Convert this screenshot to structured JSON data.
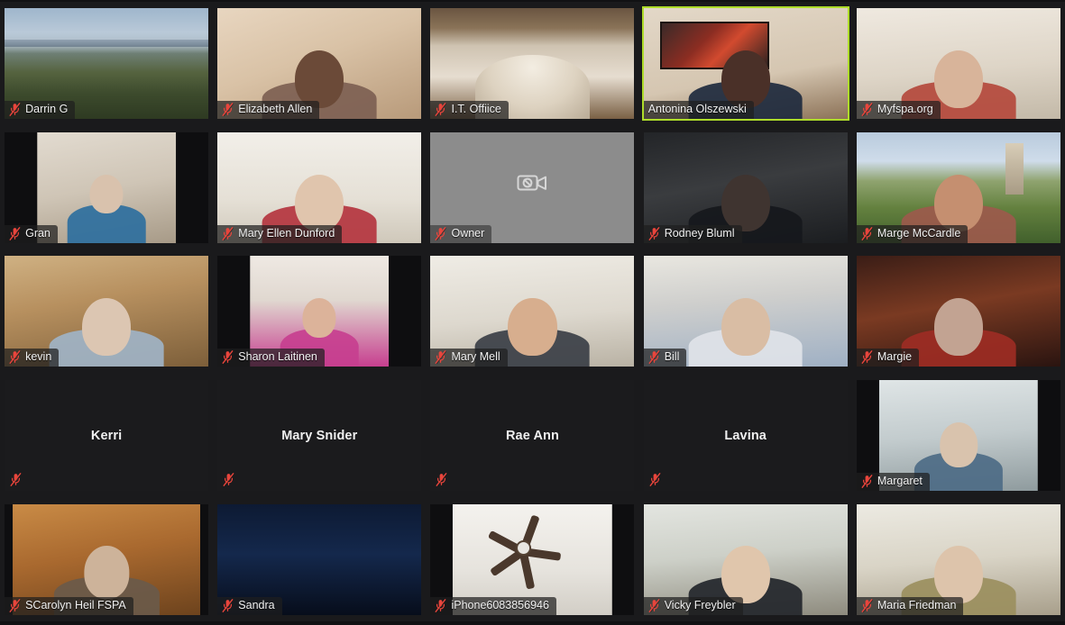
{
  "app": {
    "name": "Zoom Meeting",
    "view": "Gallery View",
    "grid": {
      "columns": 5,
      "rows": 5
    },
    "colors": {
      "background": "#111113",
      "active_speaker_border": "#aedc2a",
      "mute_icon": "#e8453c",
      "name_label_text": "#f2f2f2",
      "video_off_tile": "#1b1b1d",
      "placeholder_tile": "#8c8c8c"
    }
  },
  "participants": [
    {
      "name": "Darrin G",
      "muted": true,
      "video": "on",
      "active_speaker": false,
      "scene": "s-lake",
      "frame": "full",
      "row": 1,
      "col": 1
    },
    {
      "name": "Elizabeth Allen",
      "muted": true,
      "video": "on",
      "active_speaker": false,
      "scene": "s-room-warm",
      "frame": "full",
      "row": 1,
      "col": 2
    },
    {
      "name": "I.T. Offiice",
      "muted": true,
      "video": "on",
      "active_speaker": false,
      "scene": "s-church",
      "frame": "full",
      "row": 1,
      "col": 3
    },
    {
      "name": "Antonina Olszewski",
      "muted": false,
      "video": "on",
      "active_speaker": true,
      "scene": "s-office-art",
      "frame": "full",
      "row": 1,
      "col": 4
    },
    {
      "name": "Myfspa.org",
      "muted": true,
      "video": "on",
      "active_speaker": false,
      "scene": "s-plain-light",
      "frame": "full",
      "row": 1,
      "col": 5
    },
    {
      "name": "Gran",
      "muted": true,
      "video": "on",
      "active_speaker": false,
      "scene": "s-beige-room",
      "frame": "w68",
      "row": 2,
      "col": 1
    },
    {
      "name": "Mary Ellen Dunford",
      "muted": true,
      "video": "on",
      "active_speaker": false,
      "scene": "s-white-room",
      "frame": "full",
      "row": 2,
      "col": 2
    },
    {
      "name": "Owner",
      "muted": true,
      "video": "placeholder",
      "active_speaker": false,
      "scene": "",
      "frame": "full",
      "row": 2,
      "col": 3
    },
    {
      "name": "Rodney Bluml",
      "muted": true,
      "video": "on",
      "active_speaker": false,
      "scene": "s-dark-room",
      "frame": "full",
      "row": 2,
      "col": 4
    },
    {
      "name": "Marge McCardle",
      "muted": true,
      "video": "on",
      "active_speaker": false,
      "scene": "s-tuscany",
      "frame": "full",
      "row": 2,
      "col": 5
    },
    {
      "name": "kevin",
      "muted": true,
      "video": "on",
      "active_speaker": false,
      "scene": "s-cabin",
      "frame": "full",
      "row": 3,
      "col": 1
    },
    {
      "name": "Sharon Laitinen",
      "muted": true,
      "video": "on",
      "active_speaker": false,
      "scene": "s-pinkbg",
      "frame": "w68",
      "row": 3,
      "col": 2
    },
    {
      "name": "Mary Mell",
      "muted": true,
      "video": "on",
      "active_speaker": false,
      "scene": "s-kitchen",
      "frame": "full",
      "row": 3,
      "col": 3
    },
    {
      "name": "Bill",
      "muted": true,
      "video": "on",
      "active_speaker": false,
      "scene": "s-blue-shirt",
      "frame": "full",
      "row": 3,
      "col": 4
    },
    {
      "name": "Margie",
      "muted": true,
      "video": "on",
      "active_speaker": false,
      "scene": "s-redroom",
      "frame": "full",
      "row": 3,
      "col": 5
    },
    {
      "name": "Kerri",
      "muted": true,
      "video": "off",
      "active_speaker": false,
      "scene": "",
      "frame": "full",
      "row": 4,
      "col": 1
    },
    {
      "name": "Mary Snider",
      "muted": true,
      "video": "off",
      "active_speaker": false,
      "scene": "",
      "frame": "full",
      "row": 4,
      "col": 2
    },
    {
      "name": "Rae Ann",
      "muted": true,
      "video": "off",
      "active_speaker": false,
      "scene": "",
      "frame": "full",
      "row": 4,
      "col": 3
    },
    {
      "name": "Lavina",
      "muted": true,
      "video": "off",
      "active_speaker": false,
      "scene": "",
      "frame": "full",
      "row": 4,
      "col": 4
    },
    {
      "name": "Margaret",
      "muted": true,
      "video": "on",
      "active_speaker": false,
      "scene": "s-clinic",
      "frame": "w78",
      "row": 4,
      "col": 5
    },
    {
      "name": "SCarolyn Heil FSPA",
      "muted": true,
      "video": "on",
      "active_speaker": false,
      "scene": "s-woodroom",
      "frame": "w92",
      "row": 5,
      "col": 1
    },
    {
      "name": "Sandra",
      "muted": true,
      "video": "on",
      "active_speaker": false,
      "scene": "s-night-blue",
      "frame": "full",
      "row": 5,
      "col": 2
    },
    {
      "name": "iPhone6083856946",
      "muted": true,
      "video": "on",
      "active_speaker": false,
      "scene": "s-fan-ceiling",
      "frame": "w78",
      "row": 5,
      "col": 3
    },
    {
      "name": "Vicky Freybler",
      "muted": true,
      "video": "on",
      "active_speaker": false,
      "scene": "s-hall",
      "frame": "full",
      "row": 5,
      "col": 4
    },
    {
      "name": "Maria Friedman",
      "muted": true,
      "video": "on",
      "active_speaker": false,
      "scene": "s-tan-wall",
      "frame": "full",
      "row": 5,
      "col": 5
    }
  ],
  "icons": {
    "mic_muted": "mic-muted-icon",
    "camera_off": "camera-off-icon"
  }
}
